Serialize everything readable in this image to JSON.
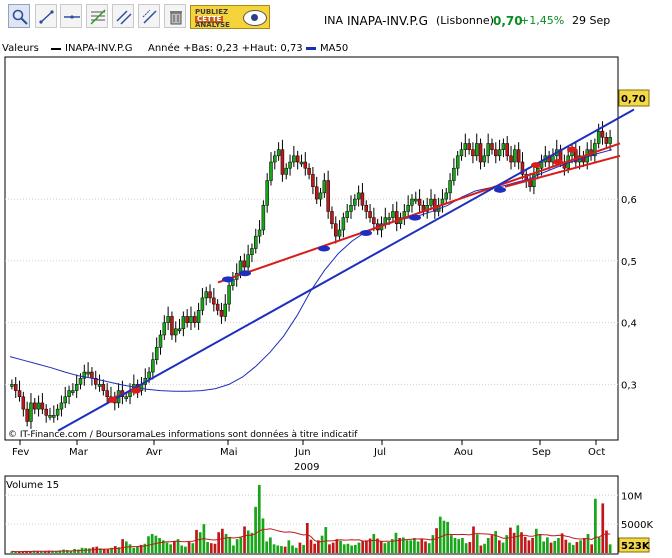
{
  "toolbar": {
    "buttons": [
      {
        "name": "zoom-icon",
        "active": true
      },
      {
        "name": "trend-line-icon"
      },
      {
        "name": "horizontal-line-icon"
      },
      {
        "name": "fibonacci-icon"
      },
      {
        "name": "parallel-lines-icon"
      },
      {
        "name": "channel-icon"
      },
      {
        "name": "trash-icon"
      }
    ],
    "promo": {
      "line1": "PUBLIEZ",
      "line2": "CETTE",
      "line3": "ANALYSE",
      "icon": "eye-icon"
    }
  },
  "symbol": {
    "code": "INA",
    "name": "INAPA-INV.P.G",
    "exchange": "(Lisbonne)",
    "price": "0,70",
    "change": "+1,45%",
    "date": "29 Sep",
    "change_color": "#0a8c1f"
  },
  "legend": {
    "values_label": "Valeurs",
    "series_name": "INAPA-INV.P.G",
    "range_text": "Année +Bas: 0,23 +Haut: 0,73",
    "ma_label": "MA50",
    "ma_color": "#1a2fb8"
  },
  "credits": "© IT-Finance.com / BoursoramaLes informations sont données à titre indicatif",
  "volume_label": "Volume 15",
  "chart_data": [
    {
      "type": "candlestick",
      "title": "",
      "y_ticks": [
        "0,3",
        "0,4",
        "0,5",
        "0,6"
      ],
      "ylim": [
        0.21,
        0.83
      ],
      "last_price_label": "0,70",
      "x_ticks": [
        "Fev",
        "Mar",
        "Avr",
        "Mai",
        "Jun",
        "Jul",
        "Aou",
        "Sep",
        "Oct"
      ],
      "year_label": "2009",
      "colors": {
        "up": "#18a518",
        "down": "#c01818",
        "ma": "#1a2fb8",
        "support": "#d81c1c",
        "trend": "#1e2fbf"
      },
      "closes": [
        0.3,
        0.29,
        0.28,
        0.26,
        0.24,
        0.27,
        0.26,
        0.27,
        0.26,
        0.25,
        0.25,
        0.25,
        0.26,
        0.27,
        0.28,
        0.29,
        0.29,
        0.3,
        0.31,
        0.32,
        0.32,
        0.31,
        0.3,
        0.3,
        0.29,
        0.28,
        0.28,
        0.27,
        0.29,
        0.28,
        0.28,
        0.29,
        0.3,
        0.29,
        0.3,
        0.31,
        0.32,
        0.34,
        0.36,
        0.38,
        0.4,
        0.41,
        0.38,
        0.39,
        0.39,
        0.41,
        0.4,
        0.41,
        0.4,
        0.42,
        0.44,
        0.45,
        0.44,
        0.43,
        0.42,
        0.41,
        0.43,
        0.46,
        0.47,
        0.48,
        0.5,
        0.49,
        0.51,
        0.52,
        0.54,
        0.55,
        0.59,
        0.63,
        0.66,
        0.67,
        0.68,
        0.64,
        0.65,
        0.66,
        0.67,
        0.66,
        0.66,
        0.65,
        0.64,
        0.62,
        0.6,
        0.61,
        0.63,
        0.58,
        0.56,
        0.54,
        0.55,
        0.57,
        0.58,
        0.59,
        0.6,
        0.61,
        0.59,
        0.58,
        0.57,
        0.56,
        0.55,
        0.56,
        0.57,
        0.57,
        0.58,
        0.56,
        0.57,
        0.58,
        0.59,
        0.6,
        0.6,
        0.59,
        0.58,
        0.59,
        0.6,
        0.58,
        0.59,
        0.6,
        0.61,
        0.63,
        0.65,
        0.67,
        0.68,
        0.69,
        0.68,
        0.67,
        0.69,
        0.66,
        0.67,
        0.69,
        0.68,
        0.67,
        0.68,
        0.69,
        0.67,
        0.66,
        0.68,
        0.66,
        0.64,
        0.63,
        0.62,
        0.64,
        0.65,
        0.66,
        0.67,
        0.66,
        0.67,
        0.68,
        0.66,
        0.65,
        0.67,
        0.68,
        0.66,
        0.67,
        0.66,
        0.68,
        0.67,
        0.69,
        0.71,
        0.7,
        0.69,
        0.7
      ],
      "ma50": [
        0.345,
        0.339,
        0.333,
        0.327,
        0.32,
        0.314,
        0.31,
        0.305,
        0.3,
        0.296,
        0.292,
        0.29,
        0.289,
        0.289,
        0.29,
        0.293,
        0.3,
        0.312,
        0.33,
        0.352,
        0.378,
        0.412,
        0.452,
        0.485,
        0.512,
        0.532,
        0.547,
        0.557,
        0.564,
        0.569,
        0.574,
        0.581,
        0.59,
        0.603,
        0.613,
        0.618,
        0.621,
        0.627,
        0.633,
        0.643,
        0.652,
        0.66,
        0.667,
        0.674,
        0.68
      ],
      "support_lines": [
        {
          "from": [
            "Fev-end",
            0.28
          ],
          "to": [
            "Mar-mid",
            0.3
          ]
        },
        {
          "from": [
            "Avr-end",
            0.47
          ],
          "to": [
            "Oct",
            0.69
          ]
        },
        {
          "from": [
            "Aou-end",
            0.62
          ],
          "to": [
            "Oct",
            0.67
          ]
        }
      ],
      "trend_line": {
        "from": [
          "Fev-mid",
          0.22
        ],
        "to": [
          "Oct",
          0.74
        ]
      }
    },
    {
      "type": "bar",
      "title": "",
      "y_ticks": [
        "5000K",
        "10M"
      ],
      "last_value_label": "523K",
      "series": [
        {
          "values_k": [
            300,
            200,
            250,
            280,
            320,
            260,
            400,
            350,
            280,
            310,
            420,
            380,
            300,
            450,
            600,
            520,
            380,
            700,
            600,
            900,
            850,
            800,
            1000,
            1100,
            800,
            700,
            600,
            900,
            1200,
            1000,
            2400,
            2000,
            1500,
            900,
            1200,
            1400,
            1600,
            2900,
            3300,
            3000,
            2600,
            2200,
            1800,
            1500,
            2000,
            2400,
            1300,
            1100,
            1900,
            1700,
            4000,
            3600,
            5000,
            1900,
            1700,
            1600,
            3600,
            4200,
            3300,
            2800,
            1300,
            2400,
            2700,
            4600,
            3900,
            3500,
            8000,
            11800,
            6000,
            2000,
            2700,
            1500,
            1300,
            1200,
            1100,
            2200,
            1300,
            900,
            1800,
            1400,
            5200,
            2300,
            1600,
            2200,
            3000,
            4500,
            1500,
            1800,
            2400,
            2100,
            1500,
            1600,
            1300,
            1400,
            1800,
            2100,
            2200,
            2500,
            3300,
            2500,
            2100,
            1700,
            1900,
            2400,
            3500,
            2600,
            2700,
            2200,
            2200,
            2600,
            2000,
            2400,
            2000,
            1700,
            3100,
            4300,
            6300,
            5600,
            5400,
            3100,
            2600,
            2400,
            2600,
            1700,
            1900,
            4600,
            3200,
            1300,
            1600,
            2600,
            3100,
            3800,
            2200,
            1800,
            3100,
            4400,
            3500,
            4800,
            3600,
            2800,
            2200,
            2600,
            4200,
            3300,
            2000,
            2700,
            1800,
            2100,
            2600,
            3400,
            2300,
            1800,
            1400,
            1900,
            2200,
            2600,
            3300,
            1500,
            9400,
            2700,
            8600,
            3900,
            1500
          ]
        }
      ],
      "average_line_color": "#c01818"
    }
  ]
}
